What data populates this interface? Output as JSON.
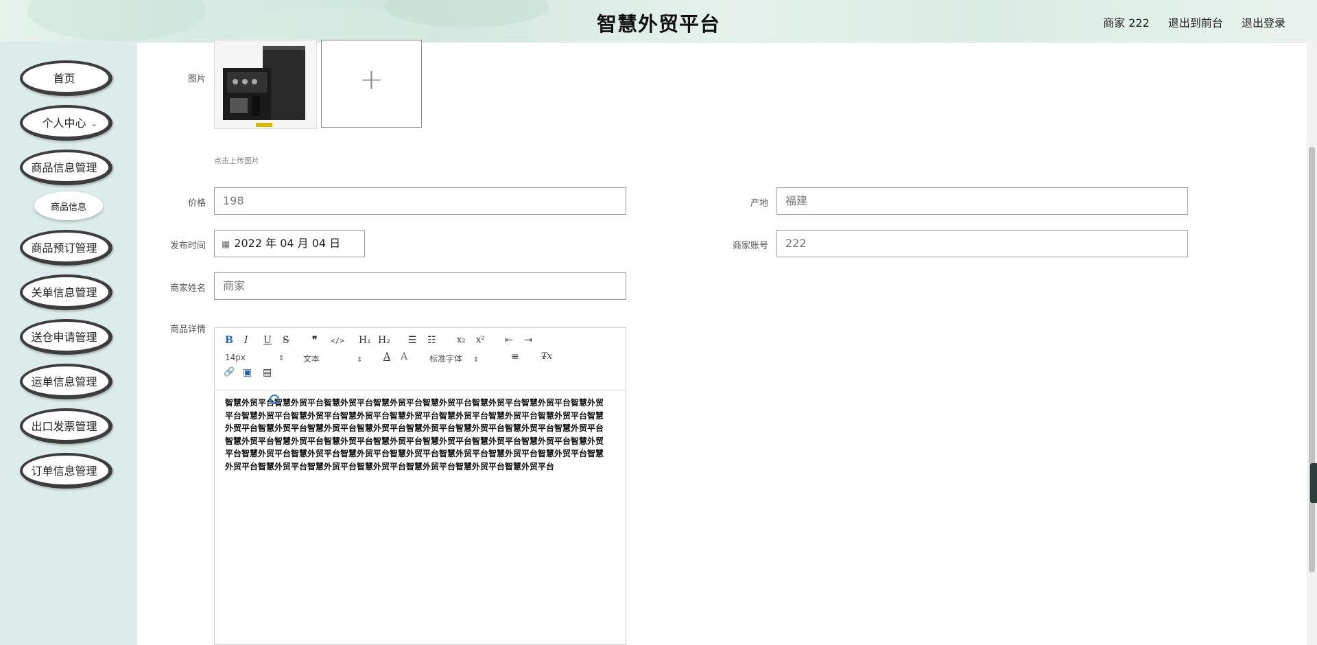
{
  "header": {
    "title": "智慧外贸平台",
    "user": "商家 222",
    "front_link": "退出到前台",
    "logout_link": "退出登录"
  },
  "sidebar": {
    "items": [
      {
        "label": "首页"
      },
      {
        "label": "个人中心",
        "has_children": true
      },
      {
        "label": "商品信息管理",
        "expanded": true,
        "children": [
          {
            "label": "商品信息"
          }
        ]
      },
      {
        "label": "商品预订管理"
      },
      {
        "label": "关单信息管理"
      },
      {
        "label": "送仓申请管理"
      },
      {
        "label": "运单信息管理"
      },
      {
        "label": "出口发票管理"
      },
      {
        "label": "订单信息管理"
      }
    ],
    "chevron": "⌄"
  },
  "form": {
    "image_label": "图片",
    "upload_hint": "点击上传图片",
    "upload_plus": "+",
    "price_label": "价格",
    "price_value": "198",
    "origin_label": "产地",
    "origin_value": "福建",
    "publish_label": "发布时间",
    "publish_value": "2022 年 04 月 04 日",
    "merchant_account_label": "商家账号",
    "merchant_account_value": "222",
    "merchant_name_label": "商家姓名",
    "merchant_name_value": "商家",
    "detail_label": "商品详情"
  },
  "editor": {
    "toolbar": {
      "bold": "B",
      "italic": "I",
      "underline": "U",
      "strike": "S",
      "quote": "❞",
      "code": "</>",
      "h1": "H₁",
      "h2": "H₂",
      "ordered_list": "☰",
      "bullet_list": "☷",
      "subscript": "x₂",
      "superscript": "x²",
      "outdent": "⇤",
      "indent": "⇥",
      "size_select": "14px",
      "header_select": "文本",
      "font_color": "A",
      "bg_color": "A",
      "font_select": "标准字体",
      "align": "≡",
      "clean": "T̶x",
      "link": "🔗",
      "image": "▣",
      "video": "▤"
    },
    "content": "智慧外贸平台智慧外贸平台智慧外贸平台智慧外贸平台智慧外贸平台智慧外贸平台智慧外贸平台智慧外贸平台智慧外贸平台智慧外贸平台智慧外贸平台智慧外贸平台智慧外贸平台智慧外贸平台智慧外贸平台智慧外贸平台智慧外贸平台智慧外贸平台智慧外贸平台智慧外贸平台智慧外贸平台智慧外贸平台智慧外贸平台智慧外贸平台智慧外贸平台智慧外贸平台智慧外贸平台智慧外贸平台智慧外贸平台智慧外贸平台智慧外贸平台智慧外贸平台智慧外贸平台智慧外贸平台智慧外贸平台智慧外贸平台智慧外贸平台智慧外贸平台智慧外贸平台智慧外贸平台智慧外贸平台智慧外贸平台智慧外贸平台智慧外贸平台智慧外贸平台"
  },
  "icons": {
    "calendar": "calendar-icon",
    "product_image": "product-image"
  }
}
